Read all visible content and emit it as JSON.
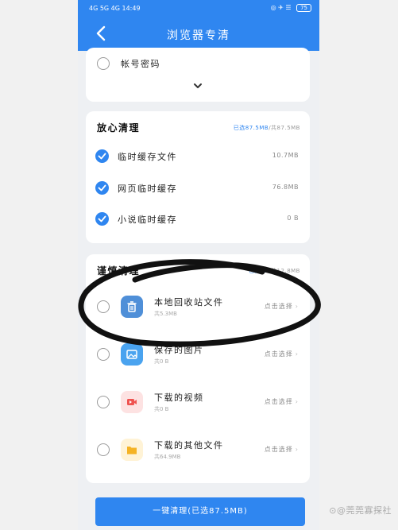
{
  "statusbar": {
    "left": "4G 5G 4G 14:49",
    "right": "◎ ✈ ☰",
    "battery": "75"
  },
  "header": {
    "title": "浏览器专清"
  },
  "account": {
    "label": "帐号密码"
  },
  "reassure": {
    "title": "放心清理",
    "selected_label": "已选87.5MB",
    "total_label": "/共87.5MB",
    "items": [
      {
        "label": "临时缓存文件",
        "size": "10.7MB"
      },
      {
        "label": "网页临时缓存",
        "size": "76.8MB"
      },
      {
        "label": "小说临时缓存",
        "size": "0 B"
      }
    ]
  },
  "careful": {
    "title": "谨慎清理",
    "selected_label": "已选0B",
    "total_label": "/共12.8MB",
    "action_label": "点击选择",
    "items": [
      {
        "name": "本地回收站文件",
        "sub": "共5.3MB",
        "icon": "trash-icon"
      },
      {
        "name": "保存的图片",
        "sub": "共0 B",
        "icon": "image-icon"
      },
      {
        "name": "下载的视频",
        "sub": "共0 B",
        "icon": "video-icon"
      },
      {
        "name": "下载的其他文件",
        "sub": "共64.9MB",
        "icon": "folder-icon"
      }
    ]
  },
  "cta": {
    "label": "一键清理(已选87.5MB)"
  },
  "watermark": {
    "text": "⊙@莞莞寡探社"
  },
  "colors": {
    "accent": "#2f86f0",
    "background": "#eef0f3"
  }
}
